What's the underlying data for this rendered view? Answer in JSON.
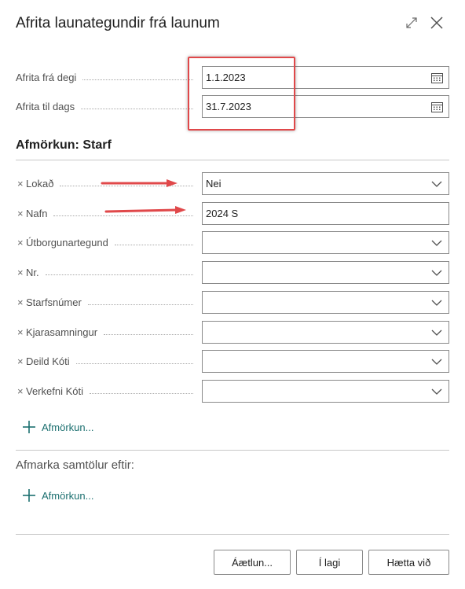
{
  "dialog": {
    "title": "Afrita launategundir frá launum",
    "expand_icon": "expand-arrows-icon",
    "close_icon": "close-icon"
  },
  "dates": {
    "from": {
      "label": "Afrita frá degi",
      "value": "1.1.2023",
      "icon": "calendar-icon"
    },
    "to": {
      "label": "Afrita til dags",
      "value": "31.7.2023",
      "icon": "calendar-icon"
    }
  },
  "filter_section": {
    "title": "Afmörkun: Starf",
    "rows": [
      {
        "label": "Lokað",
        "value": "Nei",
        "type": "dropdown"
      },
      {
        "label": "Nafn",
        "value": "2024 S",
        "type": "text"
      },
      {
        "label": "Útborgunartegund",
        "value": "",
        "type": "dropdown"
      },
      {
        "label": "Nr.",
        "value": "",
        "type": "dropdown"
      },
      {
        "label": "Starfsnúmer",
        "value": "",
        "type": "dropdown"
      },
      {
        "label": "Kjarasamningur",
        "value": "",
        "type": "dropdown"
      },
      {
        "label": "Deild Kóti",
        "value": "",
        "type": "dropdown"
      },
      {
        "label": "Verkefni Kóti",
        "value": "",
        "type": "dropdown"
      }
    ],
    "add_filter_label": "Afmörkun..."
  },
  "totals_section": {
    "title": "Afmarka samtölur eftir:",
    "add_filter_label": "Afmörkun..."
  },
  "footer": {
    "schedule_label": "Áætlun...",
    "ok_label": "Í lagi",
    "cancel_label": "Hætta við"
  },
  "colors": {
    "accent": "#1b6f6f",
    "annotation_red": "#e0484a",
    "field_border": "#8a8a8a"
  }
}
